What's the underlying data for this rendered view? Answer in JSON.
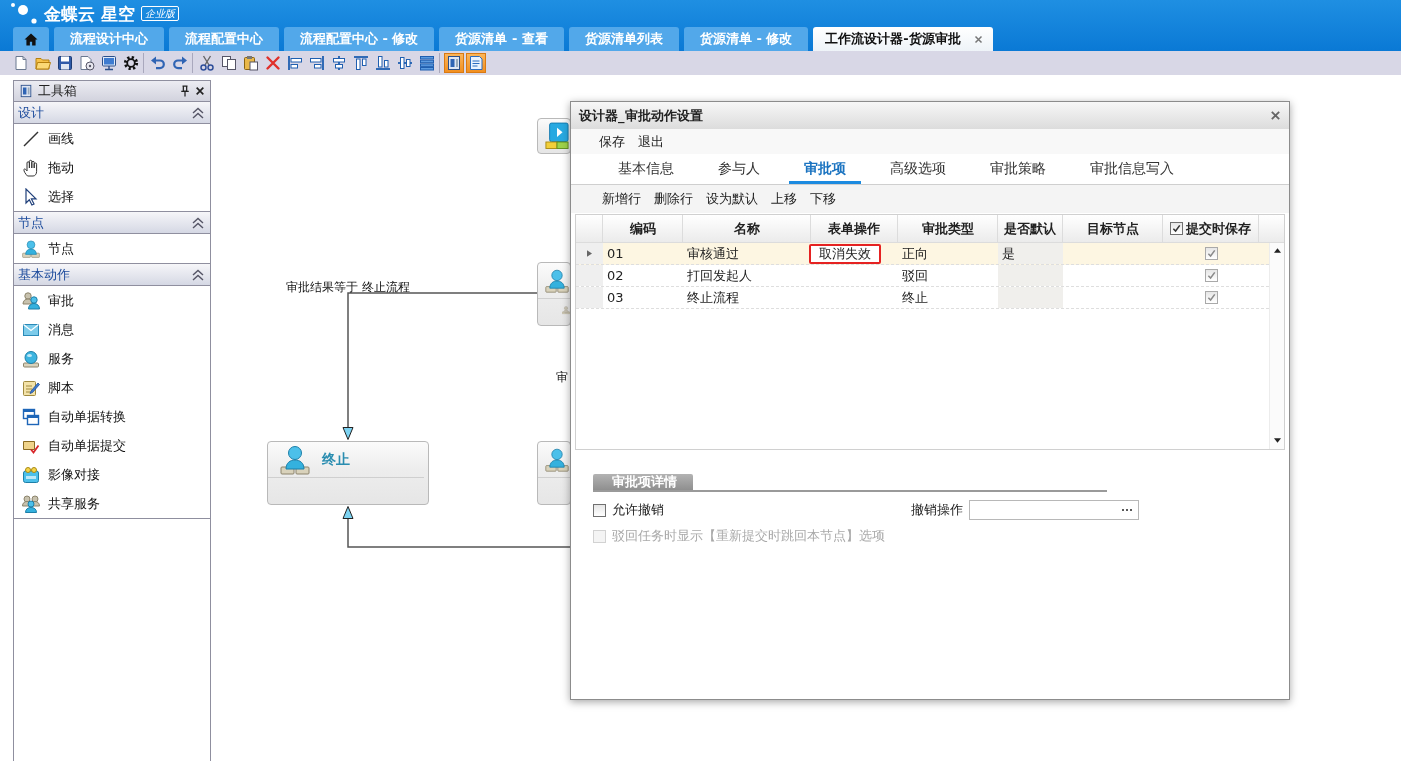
{
  "header": {
    "logo": "金蝶云 星空",
    "edition": "企业版"
  },
  "tabs": [
    {
      "kind": "home",
      "selected": false,
      "closable": false
    },
    {
      "kind": "text",
      "label": "流程设计中心",
      "selected": false,
      "closable": false
    },
    {
      "kind": "text",
      "label": "流程配置中心",
      "selected": false,
      "closable": false
    },
    {
      "kind": "text",
      "label": "流程配置中心 - 修改",
      "selected": false,
      "closable": false
    },
    {
      "kind": "text",
      "label": "货源清单 - 查看",
      "selected": false,
      "closable": false
    },
    {
      "kind": "text",
      "label": "货源清单列表",
      "selected": false,
      "closable": false
    },
    {
      "kind": "text",
      "label": "货源清单 - 修改",
      "selected": false,
      "closable": false
    },
    {
      "kind": "text",
      "label": "工作流设计器-货源审批",
      "selected": true,
      "closable": true
    }
  ],
  "toolbar": {
    "groups": [
      {
        "buttons": [
          {
            "kind": "new",
            "on": false
          },
          {
            "kind": "open",
            "on": false
          },
          {
            "kind": "save",
            "on": false
          },
          {
            "kind": "preview",
            "on": false
          },
          {
            "kind": "monitor",
            "on": false
          },
          {
            "kind": "settings",
            "on": false
          }
        ]
      },
      {
        "buttons": [
          {
            "kind": "undo",
            "on": false
          },
          {
            "kind": "redo",
            "on": false
          }
        ]
      },
      {
        "buttons": [
          {
            "kind": "cut",
            "on": false
          },
          {
            "kind": "copy",
            "on": false
          },
          {
            "kind": "paste",
            "on": false
          },
          {
            "kind": "delete",
            "on": false
          },
          {
            "kind": "alignleft",
            "on": false
          },
          {
            "kind": "alignright",
            "on": false
          },
          {
            "kind": "centerh",
            "on": false
          },
          {
            "kind": "aligntop",
            "on": false
          },
          {
            "kind": "alignbottom",
            "on": false
          },
          {
            "kind": "centerv",
            "on": false
          },
          {
            "kind": "stack",
            "on": false
          }
        ]
      },
      {
        "buttons": [
          {
            "kind": "toolbox",
            "on": true
          },
          {
            "kind": "notes",
            "on": true
          }
        ]
      }
    ]
  },
  "toolbox": {
    "title": "工具箱",
    "sections": [
      {
        "title": "设计",
        "expanded": true,
        "items": [
          {
            "kind": "line",
            "label": "画线"
          },
          {
            "kind": "hand",
            "label": "拖动"
          },
          {
            "kind": "pointer",
            "label": "选择"
          }
        ]
      },
      {
        "title": "节点",
        "expanded": true,
        "items": [
          {
            "kind": "node",
            "label": "节点"
          }
        ]
      },
      {
        "title": "基本动作",
        "expanded": true,
        "items": [
          {
            "kind": "approval",
            "label": "审批"
          },
          {
            "kind": "message",
            "label": "消息"
          },
          {
            "kind": "service",
            "label": "服务"
          },
          {
            "kind": "script",
            "label": "脚本"
          },
          {
            "kind": "convert",
            "label": "自动单据转换"
          },
          {
            "kind": "submit",
            "label": "自动单据提交"
          },
          {
            "kind": "image",
            "label": "影像对接"
          },
          {
            "kind": "share",
            "label": "共享服务"
          }
        ]
      }
    ]
  },
  "canvas": {
    "nodes": [
      {
        "kind": "start",
        "sub_icon": false
      },
      {
        "kind": "activity",
        "sub_icon": true
      },
      {
        "kind": "activity",
        "label": "终止",
        "sub_icon": false
      },
      {
        "kind": "activity",
        "sub_icon": false
      }
    ],
    "connectors": [
      {
        "kind": "top",
        "label": "审批结果等于 终止流程"
      },
      {
        "kind": "hidden",
        "label": "审"
      },
      {
        "kind": "bottom"
      }
    ]
  },
  "dialog": {
    "title": "设计器_审批动作设置",
    "menu": [
      "保存",
      "退出"
    ],
    "tabs": [
      {
        "label": "基本信息",
        "selected": false
      },
      {
        "label": "参与人",
        "selected": false
      },
      {
        "label": "审批项",
        "selected": true
      },
      {
        "label": "高级选项",
        "selected": false
      },
      {
        "label": "审批策略",
        "selected": false
      },
      {
        "label": "审批信息写入",
        "selected": false
      }
    ],
    "grid_toolbar": [
      "新增行",
      "删除行",
      "设为默认",
      "上移",
      "下移"
    ],
    "grid": {
      "columns": [
        {
          "kind": "text",
          "label": "编码"
        },
        {
          "kind": "text",
          "label": "名称"
        },
        {
          "kind": "text",
          "label": "表单操作"
        },
        {
          "kind": "text",
          "label": "审批类型"
        },
        {
          "kind": "text",
          "label": "是否默认"
        },
        {
          "kind": "text",
          "label": "目标节点"
        },
        {
          "kind": "checkbox",
          "label": "提交时保存",
          "checked": true
        }
      ],
      "rows": [
        {
          "selected": true,
          "code": "01",
          "name": "审核通过",
          "form_action": "取消失效",
          "form_action_editing": true,
          "approval_type": "正向",
          "default": "是",
          "save_on_submit": true
        },
        {
          "selected": false,
          "code": "02",
          "name": "打回发起人",
          "form_action_editing": false,
          "approval_type": "驳回",
          "save_on_submit": true
        },
        {
          "selected": false,
          "code": "03",
          "name": "终止流程",
          "form_action_editing": false,
          "approval_type": "终止",
          "save_on_submit": true
        }
      ]
    },
    "details": {
      "title": "审批项详情",
      "allow_revoke": {
        "label": "允许撤销",
        "checked": false,
        "disabled": false
      },
      "revoke_action": {
        "label": "撤销操作"
      },
      "reject_option": {
        "label": "驳回任务时显示【重新提交时跳回本节点】选项",
        "checked": false,
        "disabled": true
      }
    }
  }
}
